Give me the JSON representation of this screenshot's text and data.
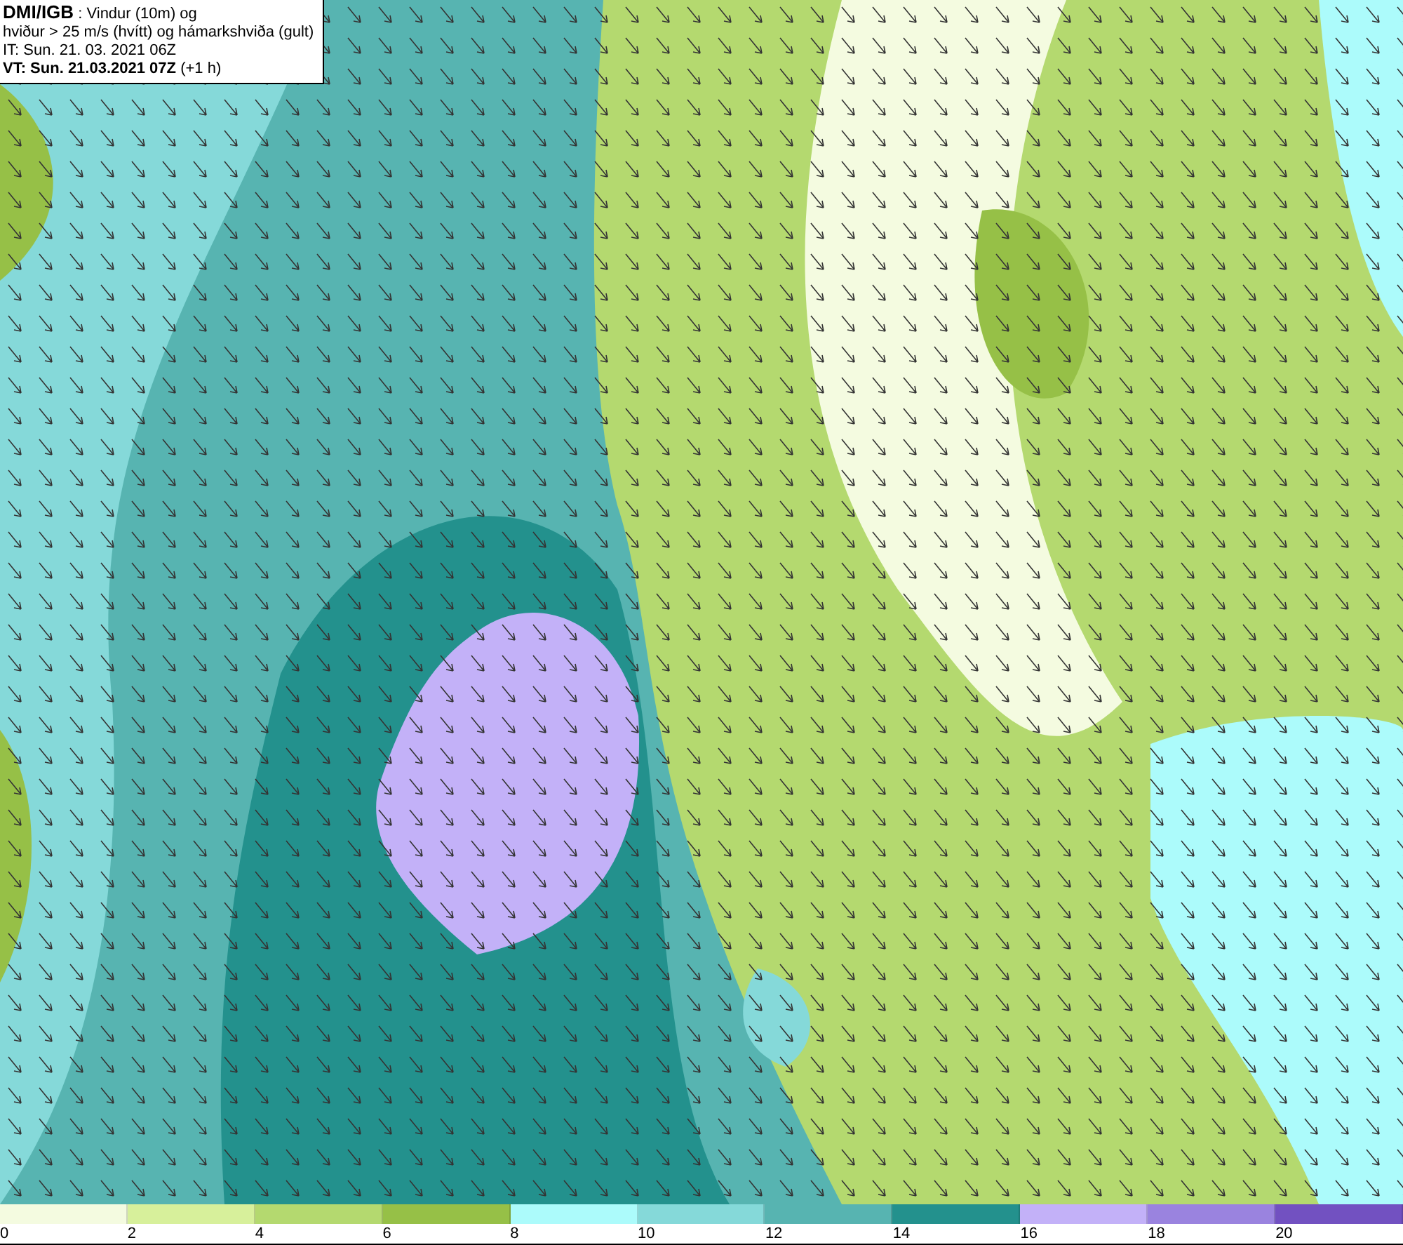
{
  "info_box": {
    "lines": [
      "**DMI/IGB** : Vindur (10m) og",
      "hviður > 25 m/s (hvítt) og hámarkshviða (gult)",
      "IT: Sun. 21. 03. 2021 06Z",
      "**VT: Sun. 21.03.2021 07Z** (+1 h)"
    ]
  },
  "legend": [
    {
      "label": "0",
      "color": "#f4fbe0"
    },
    {
      "label": "2",
      "color": "#d7f09b"
    },
    {
      "label": "4",
      "color": "#b4d96f"
    },
    {
      "label": "6",
      "color": "#96c047"
    },
    {
      "label": "8",
      "color": "#acfbfb"
    },
    {
      "label": "10",
      "color": "#85d9d9"
    },
    {
      "label": "12",
      "color": "#57b4b1"
    },
    {
      "label": "14",
      "color": "#23918d"
    },
    {
      "label": "16",
      "color": "#c3b1f8"
    },
    {
      "label": "18",
      "color": "#9a83df"
    },
    {
      "label": "20",
      "color": "#7251c1"
    }
  ]
}
